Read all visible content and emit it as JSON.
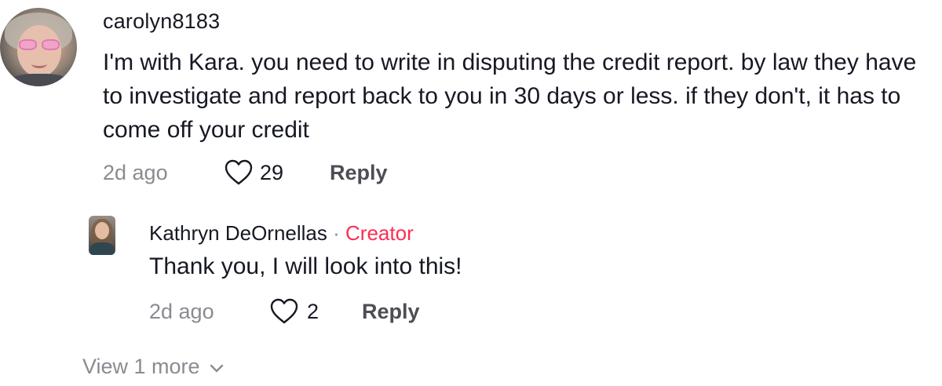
{
  "comment": {
    "username": "carolyn8183",
    "text": "I'm with Kara. you need to write in disputing the credit report. by law they have to investigate and report back to you in 30 days or less. if they don't, it has to come off your credit",
    "time": "2d ago",
    "likes": "29",
    "reply_label": "Reply",
    "avatar_icon": "user-avatar"
  },
  "reply": {
    "username": "Kathryn DeOrnellas",
    "separator": "·",
    "badge": "Creator",
    "text": "Thank you, I will look into this!",
    "time": "2d ago",
    "likes": "2",
    "reply_label": "Reply",
    "avatar_icon": "user-avatar"
  },
  "view_more": {
    "label": "View 1 more",
    "icon": "chevron-down-icon"
  },
  "colors": {
    "text": "#161823",
    "muted": "#8a8b91",
    "creator_badge": "#fe2c55",
    "reply_button": "#4d4e55"
  }
}
